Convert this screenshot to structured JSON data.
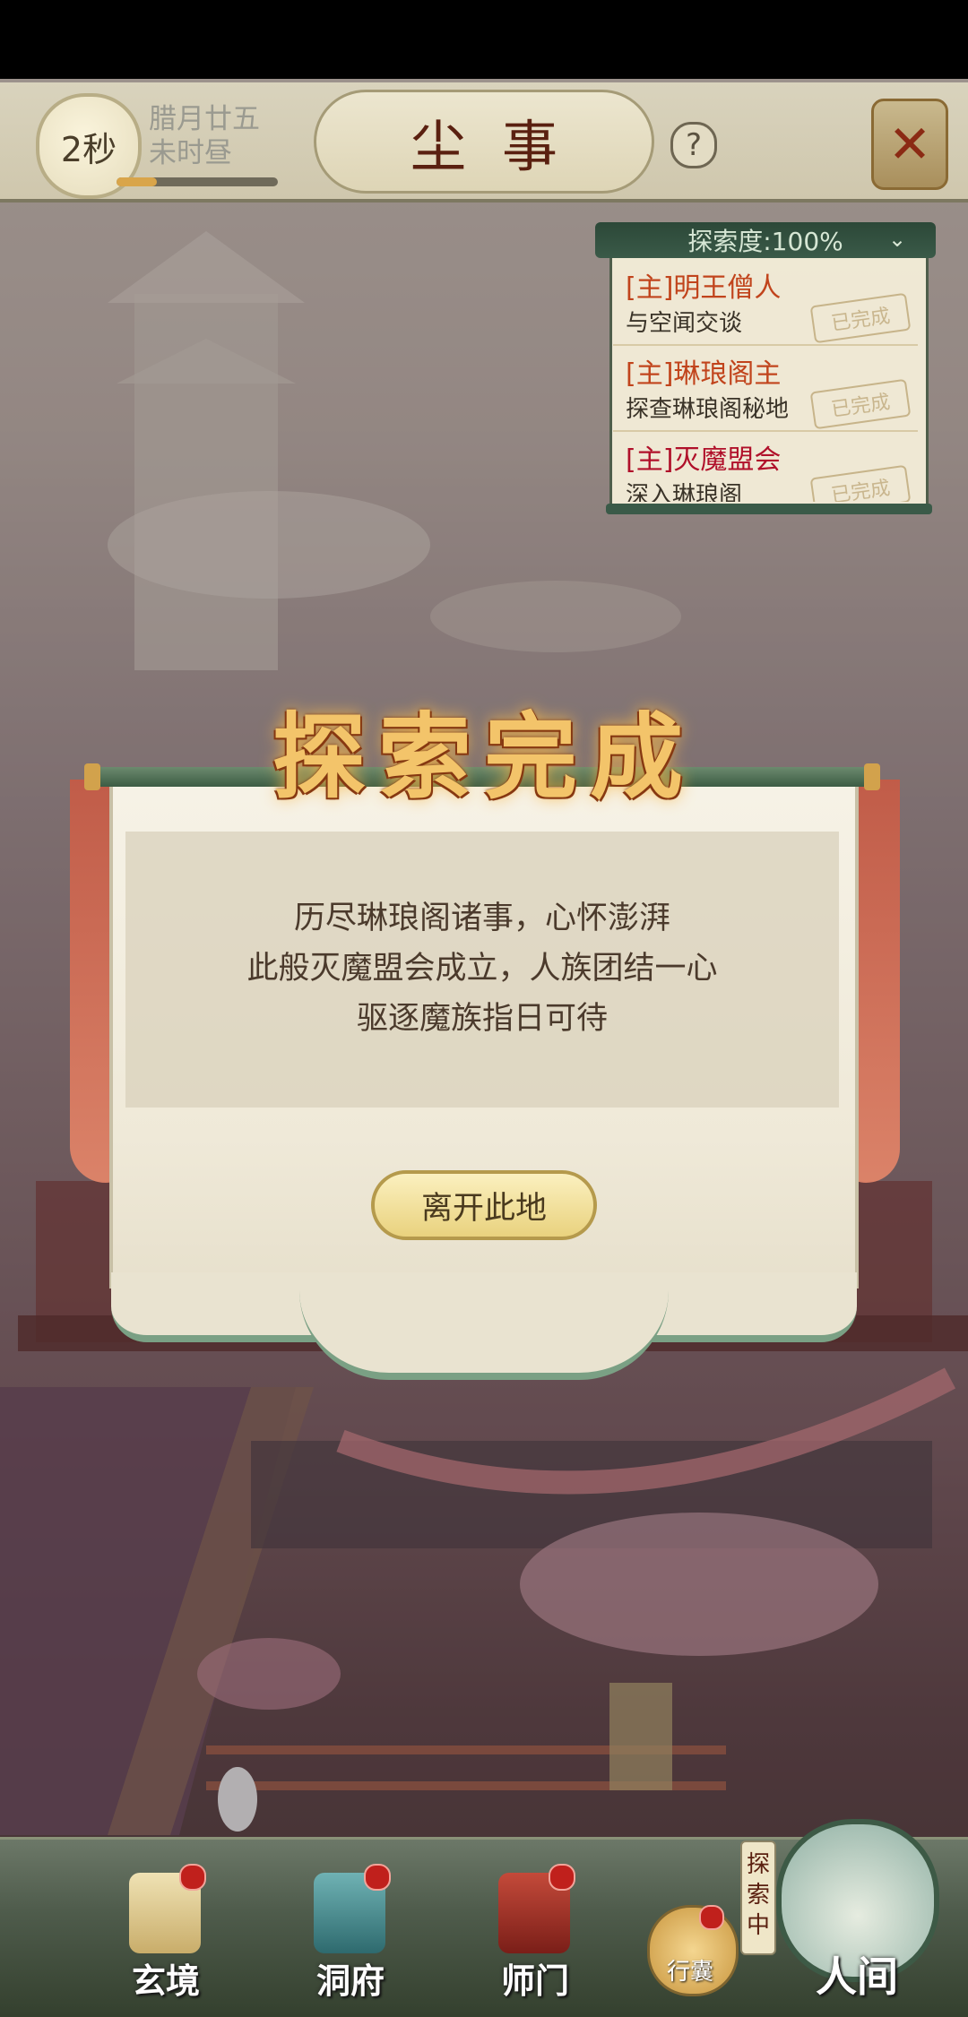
{
  "top_bar": {
    "timer": "2秒",
    "date_line1": "腊月廿五",
    "date_line2": "未时昼",
    "title": "尘事",
    "help_label": "?",
    "close_label": "✕",
    "progress": 0.25
  },
  "quest_panel": {
    "header": "探索度:100%",
    "toggle_label": "⌄",
    "items": [
      {
        "title": "[主]明王僧人",
        "desc": "与空闻交谈",
        "status": "已完成"
      },
      {
        "title": "[主]琳琅阁主",
        "desc": "探查琳琅阁秘地",
        "status": "已完成"
      },
      {
        "title": "[主]灭魔盟会",
        "desc": "深入琳琅阁",
        "status": "已完成"
      }
    ]
  },
  "dialog": {
    "title": "探索完成",
    "lines": [
      "历尽琳琅阁诸事，心怀澎湃",
      "此般灭魔盟会成立，人族团结一心",
      "驱逐魔族指日可待"
    ],
    "button": "离开此地"
  },
  "bottom_nav": {
    "items": [
      {
        "label": "玄境"
      },
      {
        "label": "洞府"
      },
      {
        "label": "师门"
      }
    ],
    "bag_label": "行囊",
    "explore_badge": "探索中",
    "main_label": "人间"
  },
  "colors": {
    "accent_gold": "#f3c46a",
    "quest_title_red": "#c1441c",
    "panel_green": "#3a5a48",
    "notification_red": "#c0201c"
  }
}
